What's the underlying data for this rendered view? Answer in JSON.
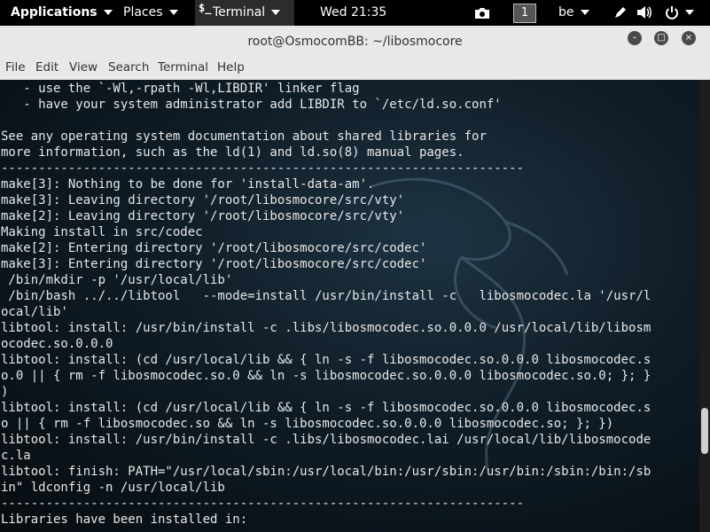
{
  "panel": {
    "applications": "Applications",
    "places": "Places",
    "task_icon": "$_",
    "task_label": "Terminal",
    "clock": "Wed 21:35",
    "workspace": "1",
    "keyboard": "be",
    "icons": [
      "camera-icon",
      "pen-icon",
      "volume-icon",
      "power-icon"
    ]
  },
  "window": {
    "title": "root@OsmocomBB: ~/libosmocore",
    "minimize": "–",
    "maximize": "□",
    "close": "×"
  },
  "menu": [
    "File",
    "Edit",
    "View",
    "Search",
    "Terminal",
    "Help"
  ],
  "terminal": {
    "lines": [
      "   - use the `-Wl,-rpath -Wl,LIBDIR' linker flag",
      "   - have your system administrator add LIBDIR to `/etc/ld.so.conf'",
      "",
      "See any operating system documentation about shared libraries for",
      "more information, such as the ld(1) and ld.so(8) manual pages.",
      "----------------------------------------------------------------------",
      "make[3]: Nothing to be done for 'install-data-am'.",
      "make[3]: Leaving directory '/root/libosmocore/src/vty'",
      "make[2]: Leaving directory '/root/libosmocore/src/vty'",
      "Making install in src/codec",
      "make[2]: Entering directory '/root/libosmocore/src/codec'",
      "make[3]: Entering directory '/root/libosmocore/src/codec'",
      " /bin/mkdir -p '/usr/local/lib'",
      " /bin/bash ../../libtool   --mode=install /usr/bin/install -c   libosmocodec.la '/usr/l",
      "ocal/lib'",
      "libtool: install: /usr/bin/install -c .libs/libosmocodec.so.0.0.0 /usr/local/lib/libosm",
      "ocodec.so.0.0.0",
      "libtool: install: (cd /usr/local/lib && { ln -s -f libosmocodec.so.0.0.0 libosmocodec.s",
      "o.0 || { rm -f libosmocodec.so.0 && ln -s libosmocodec.so.0.0.0 libosmocodec.so.0; }; }",
      ")",
      "libtool: install: (cd /usr/local/lib && { ln -s -f libosmocodec.so.0.0.0 libosmocodec.s",
      "o || { rm -f libosmocodec.so && ln -s libosmocodec.so.0.0.0 libosmocodec.so; }; })",
      "libtool: install: /usr/bin/install -c .libs/libosmocodec.lai /usr/local/lib/libosmocode",
      "c.la",
      "libtool: finish: PATH=\"/usr/local/sbin:/usr/local/bin:/usr/sbin:/usr/bin:/sbin:/bin:/sb",
      "in\" ldconfig -n /usr/local/lib",
      "----------------------------------------------------------------------",
      "Libraries have been installed in:"
    ]
  }
}
